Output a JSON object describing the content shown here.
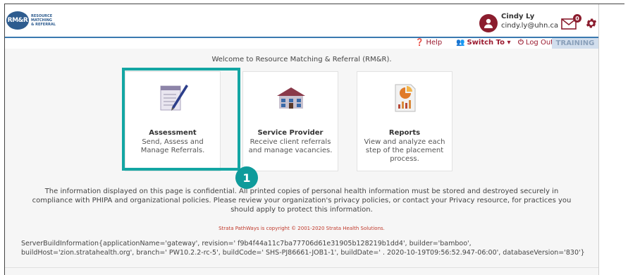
{
  "header": {
    "logo_short": "RM&R",
    "logo_lines": [
      "RESOURCE",
      "MATCHING",
      "& REFERRAL"
    ],
    "user_name": "Cindy Ly",
    "user_email": "cindy.ly@uhn.ca",
    "mail_count": "0"
  },
  "nav": {
    "help": "Help",
    "switch_to": "Switch To",
    "logout": "Log Out",
    "training": "TRAINING"
  },
  "main": {
    "welcome": "Welcome to Resource Matching & Referral (RM&R).",
    "cards": [
      {
        "title": "Assessment",
        "description": "Send, Assess and Manage Referrals."
      },
      {
        "title": "Service Provider",
        "description": "Receive client referrals and manage vacancies."
      },
      {
        "title": "Reports",
        "description": "View and analyze each step of the placement process."
      }
    ],
    "step_marker": "1",
    "confidential": "The information displayed on this page is confidential. All printed copies of personal health information must be stored and destroyed securely in compliance with PHIPA and organizational policies. Please review your organization's privacy policies, or contact your Privacy resource, for practices you should apply to protect this information.",
    "copyright": "Strata PathWays is copyright © 2001-2020 Strata Health Solutions.",
    "build_info": "ServerBuildInformation{applicationName='gateway', revision=' f9b4f44a11c7ba77706d61e31905b128219b1dd4', builder='bamboo', buildHost='zion.stratahealth.org', branch=' PW10.2.2-rc-5', buildCode=' SHS-PJ86661-JOB1-1', buildDate=' . 2020-10-19T09:56:52.947-06:00', databaseVersion='830'}"
  },
  "colors": {
    "accent": "#8b1d2e",
    "nav_blue": "#3a79b0",
    "highlight": "#13a6a3"
  }
}
